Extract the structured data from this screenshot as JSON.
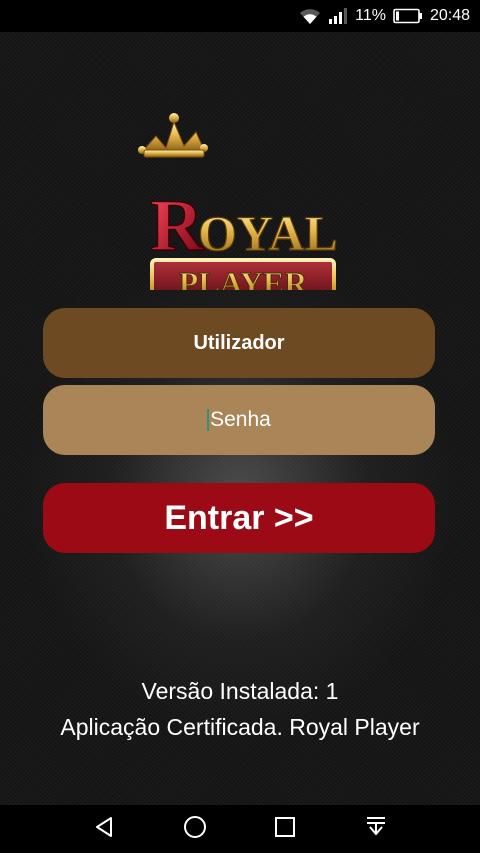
{
  "status_bar": {
    "battery_percent": "11%",
    "time": "20:48",
    "icons": [
      "wifi-icon",
      "signal-icon",
      "battery-icon"
    ]
  },
  "logo": {
    "text_royal": "ROYAL",
    "text_player": "PLAYER",
    "icons": [
      "crown-icon"
    ]
  },
  "form": {
    "username_placeholder": "Utilizador",
    "password_placeholder": "Senha",
    "submit_label": "Entrar >>"
  },
  "footer": {
    "version_text": "Versão Instalada: 1",
    "certified_text": "Aplicação Certificada. Royal Player"
  },
  "nav_bar": {
    "icons": [
      "back-icon",
      "home-icon",
      "recents-icon",
      "notifications-pull-icon"
    ]
  },
  "colors": {
    "username_bg": "#6e4a22",
    "password_bg": "#a98557",
    "button_bg": "#9c0a16",
    "background": "#141414"
  }
}
